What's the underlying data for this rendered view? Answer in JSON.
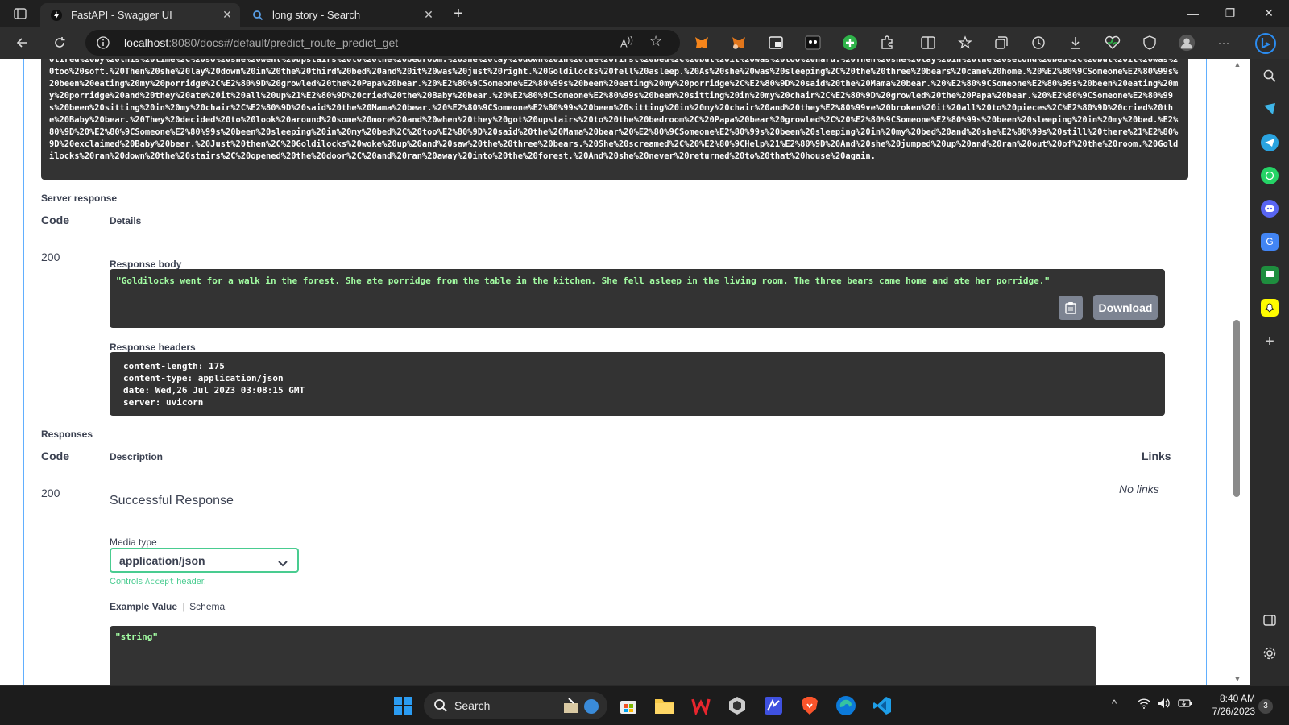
{
  "tabs": [
    {
      "title": "FastAPI - Swagger UI",
      "active": true
    },
    {
      "title": "long story - Search",
      "active": false
    }
  ],
  "address": {
    "host": "localhost",
    "path": ":8080/docs#/default/predict_route_predict_get"
  },
  "request_url_text": "0tired%20by%20this%20time%2C%20so%20she%20went%20upstairs%20to%20the%20bedroom.%20She%20lay%20down%20in%20the%20first%20bed%2C%20but%20it%20was%20too%20hard.%20Then%20she%20lay%20in%20the%20second%20bed%2C%20but%20it%20was%20too%20soft.%20Then%20she%20lay%20down%20in%20the%20third%20bed%20and%20it%20was%20just%20right.%20Goldilocks%20fell%20asleep.%20As%20she%20was%20sleeping%2C%20the%20three%20bears%20came%20home.%20%E2%80%9CSomeone%E2%80%99s%20been%20eating%20my%20porridge%2C%E2%80%9D%20growled%20the%20Papa%20bear.%20%E2%80%9CSomeone%E2%80%99s%20been%20eating%20my%20porridge%2C%E2%80%9D%20said%20the%20Mama%20bear.%20%E2%80%9CSomeone%E2%80%99s%20been%20eating%20my%20porridge%20and%20they%20ate%20it%20all%20up%21%E2%80%9D%20cried%20the%20Baby%20bear.%20%E2%80%9CSomeone%E2%80%99s%20been%20sitting%20in%20my%20chair%2C%E2%80%9D%20growled%20the%20Papa%20bear.%20%E2%80%9CSomeone%E2%80%99s%20been%20sitting%20in%20my%20chair%2C%E2%80%9D%20said%20the%20Mama%20bear.%20%E2%80%9CSomeone%E2%80%99s%20been%20sitting%20in%20my%20chair%20and%20they%E2%80%99ve%20broken%20it%20all%20to%20pieces%2C%E2%80%9D%20cried%20the%20Baby%20bear.%20They%20decided%20to%20look%20around%20some%20more%20and%20when%20they%20got%20upstairs%20to%20the%20bedroom%2C%20Papa%20bear%20growled%2C%20%E2%80%9CSomeone%E2%80%99s%20been%20sleeping%20in%20my%20bed.%E2%80%9D%20%E2%80%9CSomeone%E2%80%99s%20been%20sleeping%20in%20my%20bed%2C%20too%E2%80%9D%20said%20the%20Mama%20bear%20%E2%80%9CSomeone%E2%80%99s%20been%20sleeping%20in%20my%20bed%20and%20she%E2%80%99s%20still%20there%21%E2%80%9D%20exclaimed%20Baby%20bear.%20Just%20then%2C%20Goldilocks%20woke%20up%20and%20saw%20the%20three%20bears.%20She%20screamed%2C%20%E2%80%9CHelp%21%E2%80%9D%20And%20she%20jumped%20up%20and%20ran%20out%20of%20the%20room.%20Goldilocks%20ran%20down%20the%20stairs%2C%20opened%20the%20door%2C%20and%20ran%20away%20into%20the%20forest.%20And%20she%20never%20returned%20to%20that%20house%20again.",
  "server_response": {
    "heading": "Server response",
    "col_code": "Code",
    "col_details": "Details",
    "code": "200",
    "body_label": "Response body",
    "body": "\"Goldilocks went for a walk in the forest. She ate porridge from the table in the kitchen. She fell asleep in the living room. The three bears came home and ate her porridge.\"",
    "download_label": "Download",
    "headers_label": "Response headers",
    "headers": [
      "content-length: 175",
      "content-type: application/json",
      "date: Wed,26 Jul 2023 03:08:15 GMT",
      "server: uvicorn"
    ]
  },
  "responses": {
    "heading": "Responses",
    "col_code": "Code",
    "col_description": "Description",
    "col_links": "Links",
    "code": "200",
    "description": "Successful Response",
    "links": "No links",
    "media_type_label": "Media type",
    "media_type": "application/json",
    "controls_prefix": "Controls",
    "controls_code": "Accept",
    "controls_suffix": "header.",
    "example_tab": "Example Value",
    "schema_tab": "Schema",
    "example_value": "\"string\""
  },
  "taskbar": {
    "search_label": "Search",
    "time": "8:40 AM",
    "date": "7/26/2023",
    "notifications": "3"
  },
  "colors": {
    "swagger_get_blue": "#61affe",
    "success_green": "#49cc90",
    "code_bg": "#333333",
    "code_green": "#a2fca2"
  }
}
